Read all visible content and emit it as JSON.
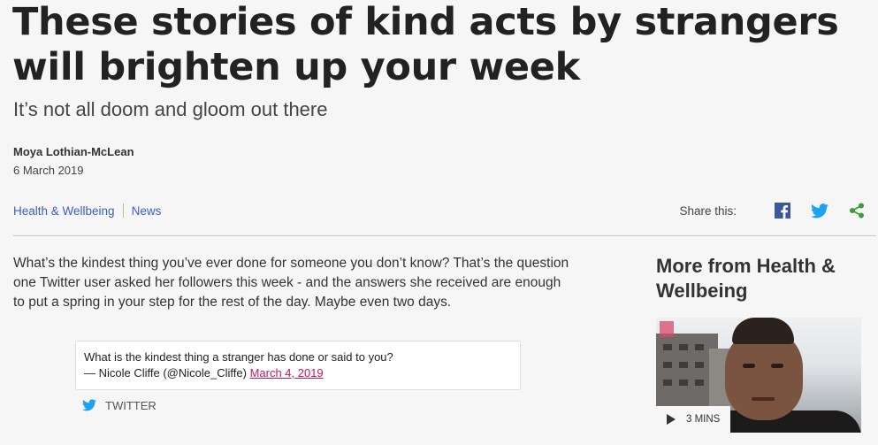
{
  "article": {
    "headline": "These stories of kind acts by strangers will brighten up your week",
    "standfirst": "It’s not all doom and gloom out there",
    "author": "Moya Lothian-McLean",
    "date": "6 March 2019",
    "tags": [
      "Health & Wellbeing",
      "News"
    ],
    "body": "What’s the kindest thing you’ve ever done for someone you don’t know? That’s the question one Twitter user asked her followers this week - and the answers she received are enough to put a spring in your step for the rest of the day. Maybe even two days."
  },
  "share": {
    "label": "Share this:",
    "icons": [
      "facebook-icon",
      "twitter-icon",
      "share-icon"
    ],
    "colors": {
      "facebook": "#3b5998",
      "twitter": "#1da1f2",
      "share": "#3a9d3a"
    }
  },
  "tweet": {
    "text": "What is the kindest thing a stranger has done or said to you?",
    "attribution": "— Nicole Cliffe (@Nicole_Cliffe)",
    "date_link": "March 4, 2019",
    "source_label": "TWITTER"
  },
  "sidebar": {
    "title": "More from Health & Wellbeing",
    "video": {
      "duration": "3 MINS"
    }
  }
}
